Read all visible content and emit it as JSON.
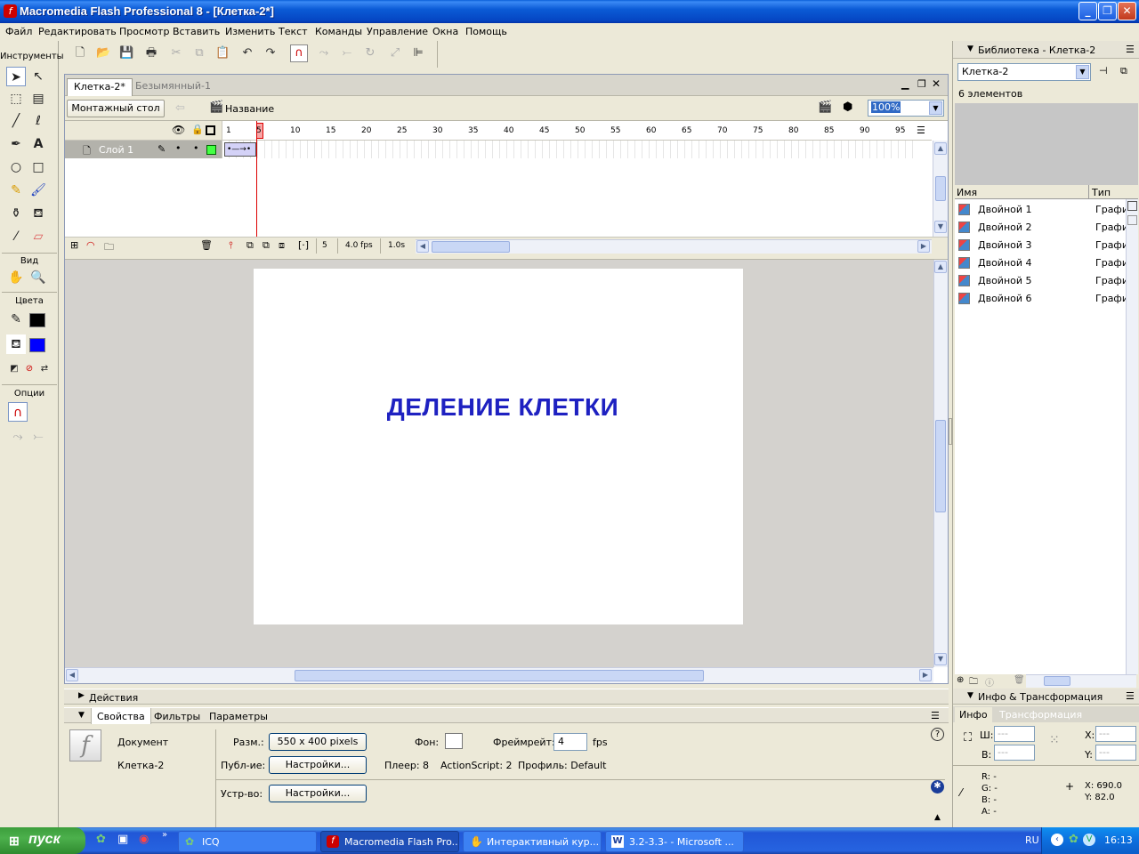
{
  "window": {
    "title": "Macromedia Flash Professional 8 - [Клетка-2*]",
    "buttons": [
      "_",
      "❐",
      "✕"
    ]
  },
  "menu": [
    "Файл",
    "Редактировать",
    "Просмотр",
    "Вставить",
    "Изменить",
    "Текст",
    "Команды",
    "Управление",
    "Окна",
    "Помощь"
  ],
  "tools": {
    "header": "Инструменты",
    "view_header": "Вид",
    "colors_header": "Цвета",
    "options_header": "Опции",
    "stroke_color": "#000000",
    "fill_color": "#0000ff"
  },
  "document": {
    "tabs": [
      "Клетка-2*",
      "Безымянный-1"
    ],
    "edit_bar": {
      "scene_button": "Монтажный стол",
      "scene_label": "Название",
      "zoom": "100%"
    },
    "timeline": {
      "layer_name": "Слой 1",
      "frame_numbers": [
        "1",
        "5",
        "10",
        "15",
        "20",
        "25",
        "30",
        "35",
        "40",
        "45",
        "50",
        "55",
        "60",
        "65",
        "70",
        "75",
        "80",
        "85",
        "90",
        "95"
      ],
      "current_frame": "5",
      "fps": "4.0 fps",
      "time": "1.0s"
    },
    "stage": {
      "text": "ДЕЛЕНИЕ КЛЕТКИ",
      "text_color": "#1e21c1"
    }
  },
  "actions_panel": {
    "title": "Действия"
  },
  "properties": {
    "tabs": [
      "Свойства",
      "Фильтры",
      "Параметры"
    ],
    "doc_type": "Документ",
    "doc_name": "Клетка-2",
    "size_label": "Разм.:",
    "size_value": "550 x 400 pixels",
    "bg_label": "Фон:",
    "framerate_label": "Фреймрейт:",
    "framerate_value": "4",
    "fps_unit": "fps",
    "publish_label": "Публ-ие:",
    "publish_button": "Настройки...",
    "player": "Плеер: 8",
    "actionscript": "ActionScript:  2",
    "profile": "Профиль: Default",
    "device_label": "Устр-во:",
    "device_button": "Настройки..."
  },
  "library": {
    "title": "Библиотека - Клетка-2",
    "selected_doc": "Клетка-2",
    "count": "6 элементов",
    "col_name": "Имя",
    "col_type": "Тип",
    "items": [
      {
        "name": "Двойной 1",
        "type": "Графи"
      },
      {
        "name": "Двойной 2",
        "type": "Графи"
      },
      {
        "name": "Двойной 3",
        "type": "Графи"
      },
      {
        "name": "Двойной 4",
        "type": "Графи"
      },
      {
        "name": "Двойной 5",
        "type": "Графи"
      },
      {
        "name": "Двойной 6",
        "type": "Графи"
      }
    ]
  },
  "info_panel": {
    "title": "Инфо & Трансформация",
    "tabs": [
      "Инфо",
      "Трансформация"
    ],
    "w_label": "Ш:",
    "w_value": "---",
    "h_label": "В:",
    "h_value": "---",
    "x_label": "X:",
    "x_value": "---",
    "y_label": "Y:",
    "y_value": "---",
    "r": "R: -",
    "g": "G: -",
    "b": "B: -",
    "a": "A: -",
    "cursor_x": "X:  690.0",
    "cursor_y": "Y:  82.0"
  },
  "taskbar": {
    "start": "пуск",
    "tasks": [
      "ICQ",
      "Macromedia Flash Pro...",
      "Интерактивный кур...",
      "3.2-3.3- - Microsoft ..."
    ],
    "lang": "RU",
    "clock": "16:13"
  }
}
